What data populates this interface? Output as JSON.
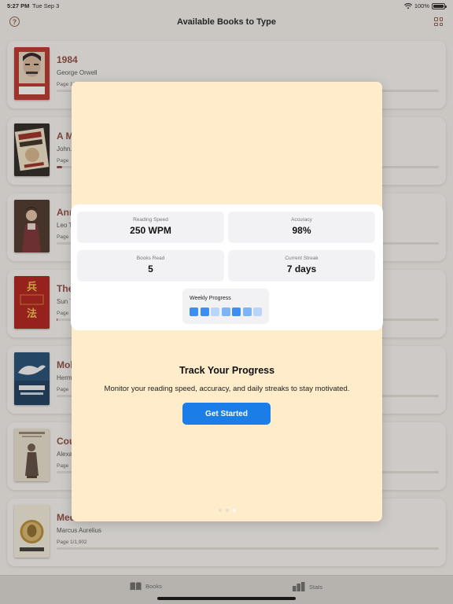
{
  "status_bar": {
    "time": "5:27 PM",
    "date": "Tue Sep 3",
    "battery": "100%"
  },
  "nav": {
    "title": "Available Books to Type",
    "help_glyph": "?"
  },
  "books": [
    {
      "title": "1984",
      "author": "George Orwell",
      "page": "Page 1/…",
      "progress": 0.0,
      "cover_text": "1984"
    },
    {
      "title": "A M…",
      "author": "John…",
      "page": "Page",
      "progress": 0.015,
      "cover_text": "A MODEST PROPOSAL"
    },
    {
      "title": "Ann…",
      "author": "Leo T…",
      "page": "Page",
      "progress": 0.0,
      "cover_text": ""
    },
    {
      "title": "The…",
      "author": "Sun T…",
      "page": "Page",
      "progress": 0.003,
      "cover_text": "THE ART OF WAR"
    },
    {
      "title": "Mob…",
      "author": "Herm…",
      "page": "Page",
      "progress": 0.0,
      "cover_text": "MOBY DICK"
    },
    {
      "title": "Cou…",
      "author": "Alexa…",
      "page": "Page",
      "progress": 0.0,
      "cover_text": ""
    },
    {
      "title": "Med…",
      "author": "Marcus Aurelius",
      "page": "Page 1/1,902",
      "progress": 0.0,
      "cover_text": "Meditations"
    }
  ],
  "tabs": [
    {
      "label": "Books",
      "icon": "book-icon"
    },
    {
      "label": "Stats",
      "icon": "stats-icon"
    }
  ],
  "onboarding": {
    "stats": [
      {
        "label": "Reading Speed",
        "value": "250 WPM"
      },
      {
        "label": "Accuracy",
        "value": "98%"
      },
      {
        "label": "Books Read",
        "value": "5"
      },
      {
        "label": "Current Streak",
        "value": "7 days"
      }
    ],
    "weekly_label": "Weekly Progress",
    "weekly_levels": [
      "high",
      "high",
      "low",
      "mid",
      "high",
      "mid",
      "low"
    ],
    "title": "Track Your Progress",
    "description": "Monitor your reading speed, accuracy, and daily streaks to stay motivated.",
    "cta": "Get Started",
    "pages": 3,
    "active_page": 2
  },
  "colors": {
    "accent": "#8b4a3e",
    "cta": "#1a7de8",
    "modal_bg": "#feeccb",
    "bar_high": "#3d8ef0",
    "bar_mid": "#7db4f5",
    "bar_low": "#b9d6fa"
  }
}
